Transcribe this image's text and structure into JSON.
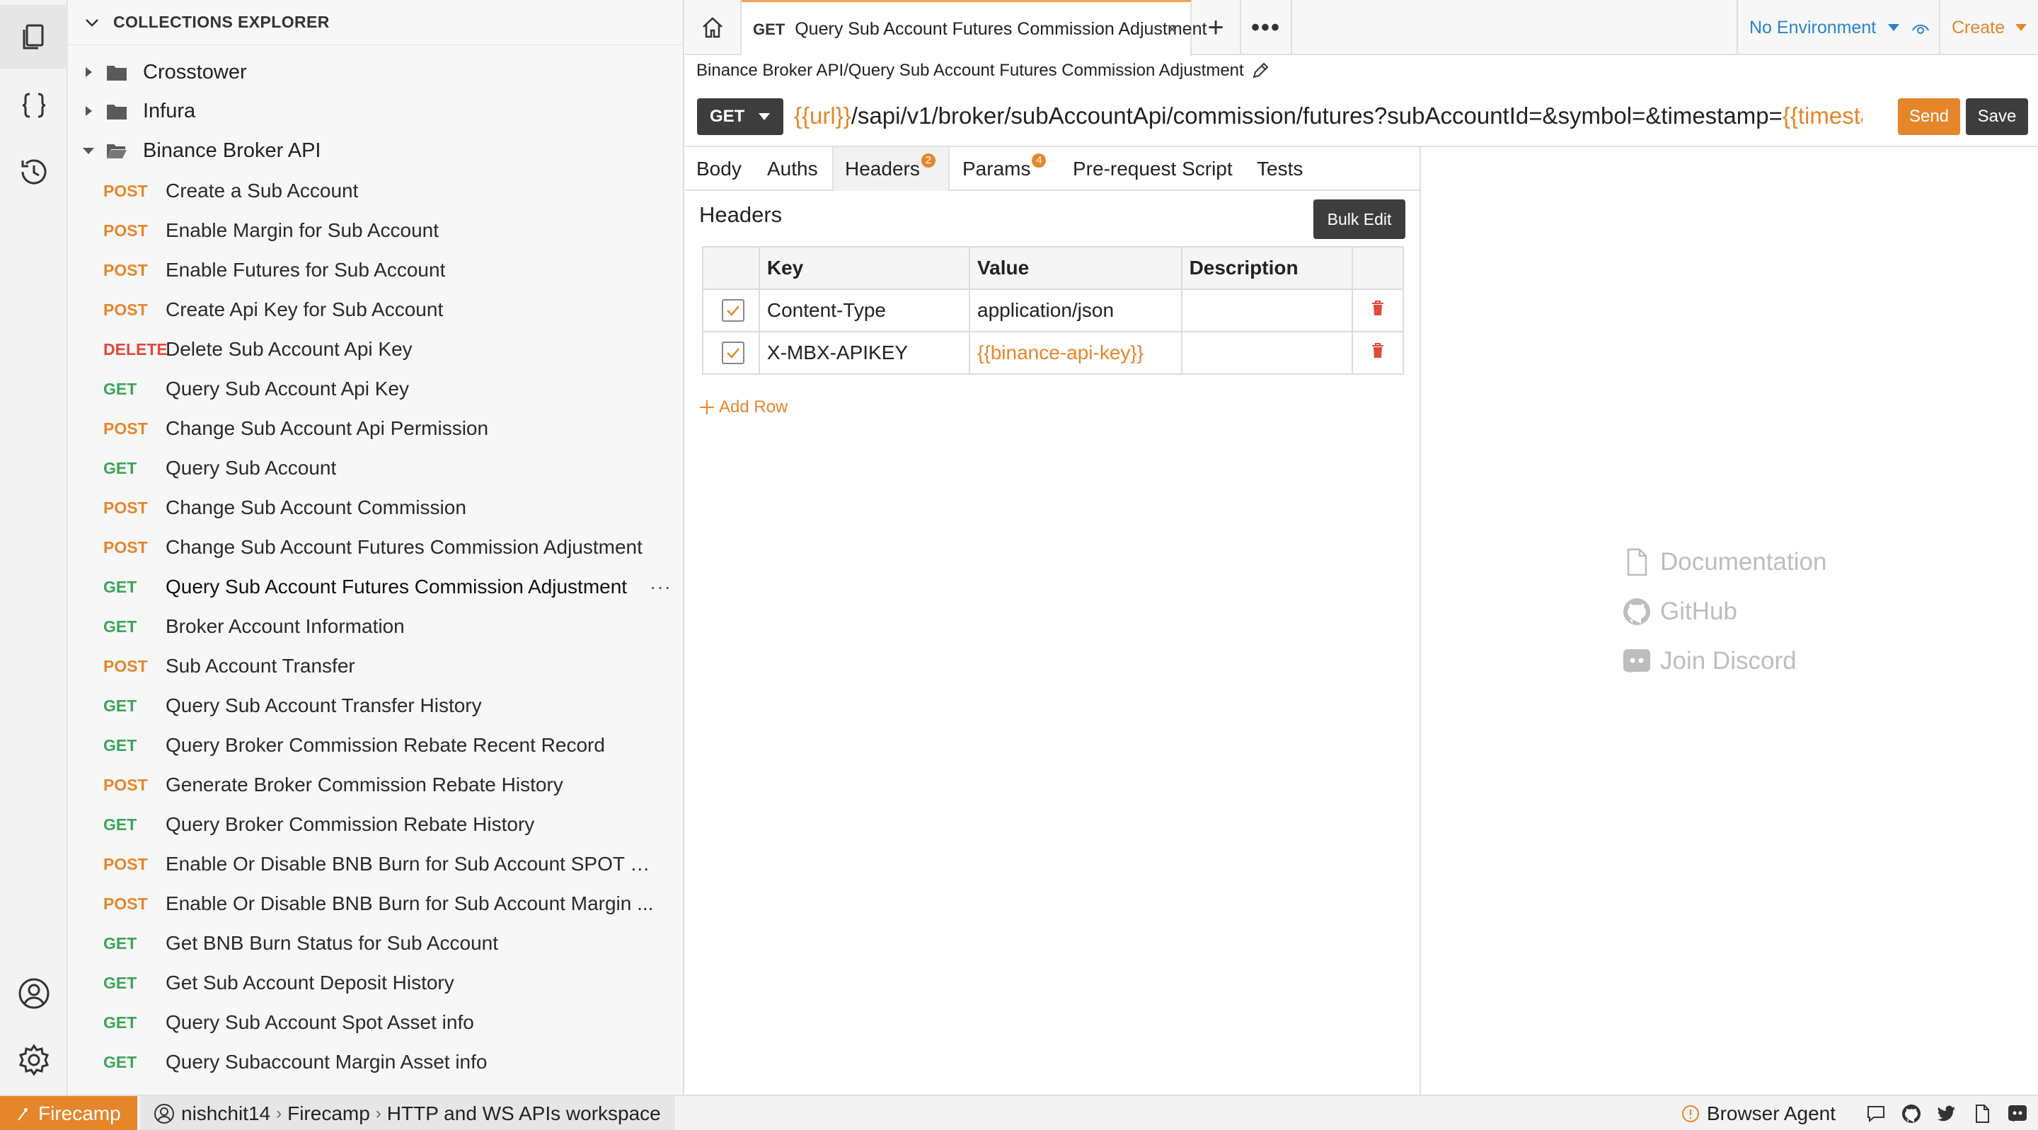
{
  "colors": {
    "accent": "#e5862a",
    "post": "#e5862a",
    "get": "#3aa657",
    "delete": "#e04a3a",
    "env": "#2b84c8",
    "dark_button": "#3d3d3d"
  },
  "explorer": {
    "title": "COLLECTIONS EXPLORER",
    "folders": [
      {
        "name": "Crosstower",
        "expanded": false
      },
      {
        "name": "Infura",
        "expanded": false
      },
      {
        "name": "Binance Broker API",
        "expanded": true
      }
    ],
    "requests": [
      {
        "method": "POST",
        "name": "Create a Sub Account"
      },
      {
        "method": "POST",
        "name": "Enable Margin for Sub Account"
      },
      {
        "method": "POST",
        "name": "Enable Futures for Sub Account"
      },
      {
        "method": "POST",
        "name": "Create Api Key for Sub Account"
      },
      {
        "method": "DELETE",
        "name": "Delete Sub Account Api Key"
      },
      {
        "method": "GET",
        "name": "Query Sub Account Api Key"
      },
      {
        "method": "POST",
        "name": "Change Sub Account Api Permission"
      },
      {
        "method": "GET",
        "name": "Query Sub Account"
      },
      {
        "method": "POST",
        "name": "Change Sub Account Commission"
      },
      {
        "method": "POST",
        "name": "Change Sub Account Futures Commission Adjustment"
      },
      {
        "method": "GET",
        "name": "Query Sub Account Futures Commission Adjustment",
        "selected": true
      },
      {
        "method": "GET",
        "name": "Broker Account Information"
      },
      {
        "method": "POST",
        "name": "Sub Account Transfer"
      },
      {
        "method": "GET",
        "name": "Query Sub Account Transfer History"
      },
      {
        "method": "GET",
        "name": "Query Broker Commission Rebate Recent Record"
      },
      {
        "method": "POST",
        "name": "Generate Broker Commission Rebate History"
      },
      {
        "method": "GET",
        "name": "Query Broker Commission Rebate History"
      },
      {
        "method": "POST",
        "name": "Enable Or Disable BNB Burn for Sub Account SPOT a..."
      },
      {
        "method": "POST",
        "name": "Enable Or Disable BNB Burn for Sub Account Margin ..."
      },
      {
        "method": "GET",
        "name": "Get BNB Burn Status for Sub Account"
      },
      {
        "method": "GET",
        "name": "Get Sub Account Deposit History"
      },
      {
        "method": "GET",
        "name": "Query Sub Account Spot Asset info"
      },
      {
        "method": "GET",
        "name": "Query Subaccount Margin Asset info"
      }
    ],
    "more_label": "···"
  },
  "tabbar": {
    "tab_method": "GET",
    "tab_title": "Query Sub Account Futures Commission Adjustment",
    "close": "×",
    "plus": "+",
    "dots": "•••",
    "environment": "No Environment",
    "create": "Create"
  },
  "request": {
    "breadcrumb": "Binance Broker API/Query Sub Account Futures Commission Adjustment",
    "method": "GET",
    "url_parts": [
      {
        "text": "{{url}}",
        "var": true
      },
      {
        "text": "/sapi/v1/broker/subAccountApi/commission/futures?subAccountId=&symbol=&timestamp=",
        "var": false
      },
      {
        "text": "{{timestamp}}",
        "var": true
      }
    ],
    "send": "Send",
    "save": "Save",
    "tabs": [
      {
        "label": "Body"
      },
      {
        "label": "Auths"
      },
      {
        "label": "Headers",
        "badge": "2",
        "active": true
      },
      {
        "label": "Params",
        "badge": "4"
      },
      {
        "label": "Pre-request Script"
      },
      {
        "label": "Tests"
      }
    ]
  },
  "headers": {
    "title": "Headers",
    "bulk_edit": "Bulk Edit",
    "columns": [
      "Key",
      "Value",
      "Description"
    ],
    "rows": [
      {
        "checked": true,
        "key": "Content-Type",
        "value": "application/json",
        "value_is_var": false,
        "description": ""
      },
      {
        "checked": true,
        "key": "X-MBX-APIKEY",
        "value": "{{binance-api-key}}",
        "value_is_var": true,
        "description": ""
      }
    ],
    "add_row": "Add Row"
  },
  "side_links": {
    "documentation": "Documentation",
    "github": "GitHub",
    "discord": "Join Discord"
  },
  "statusbar": {
    "brand": "Firecamp",
    "user": "nishchit14",
    "org": "Firecamp",
    "workspace": "HTTP and WS APIs workspace",
    "sep": "›",
    "browser_agent": "Browser Agent"
  }
}
